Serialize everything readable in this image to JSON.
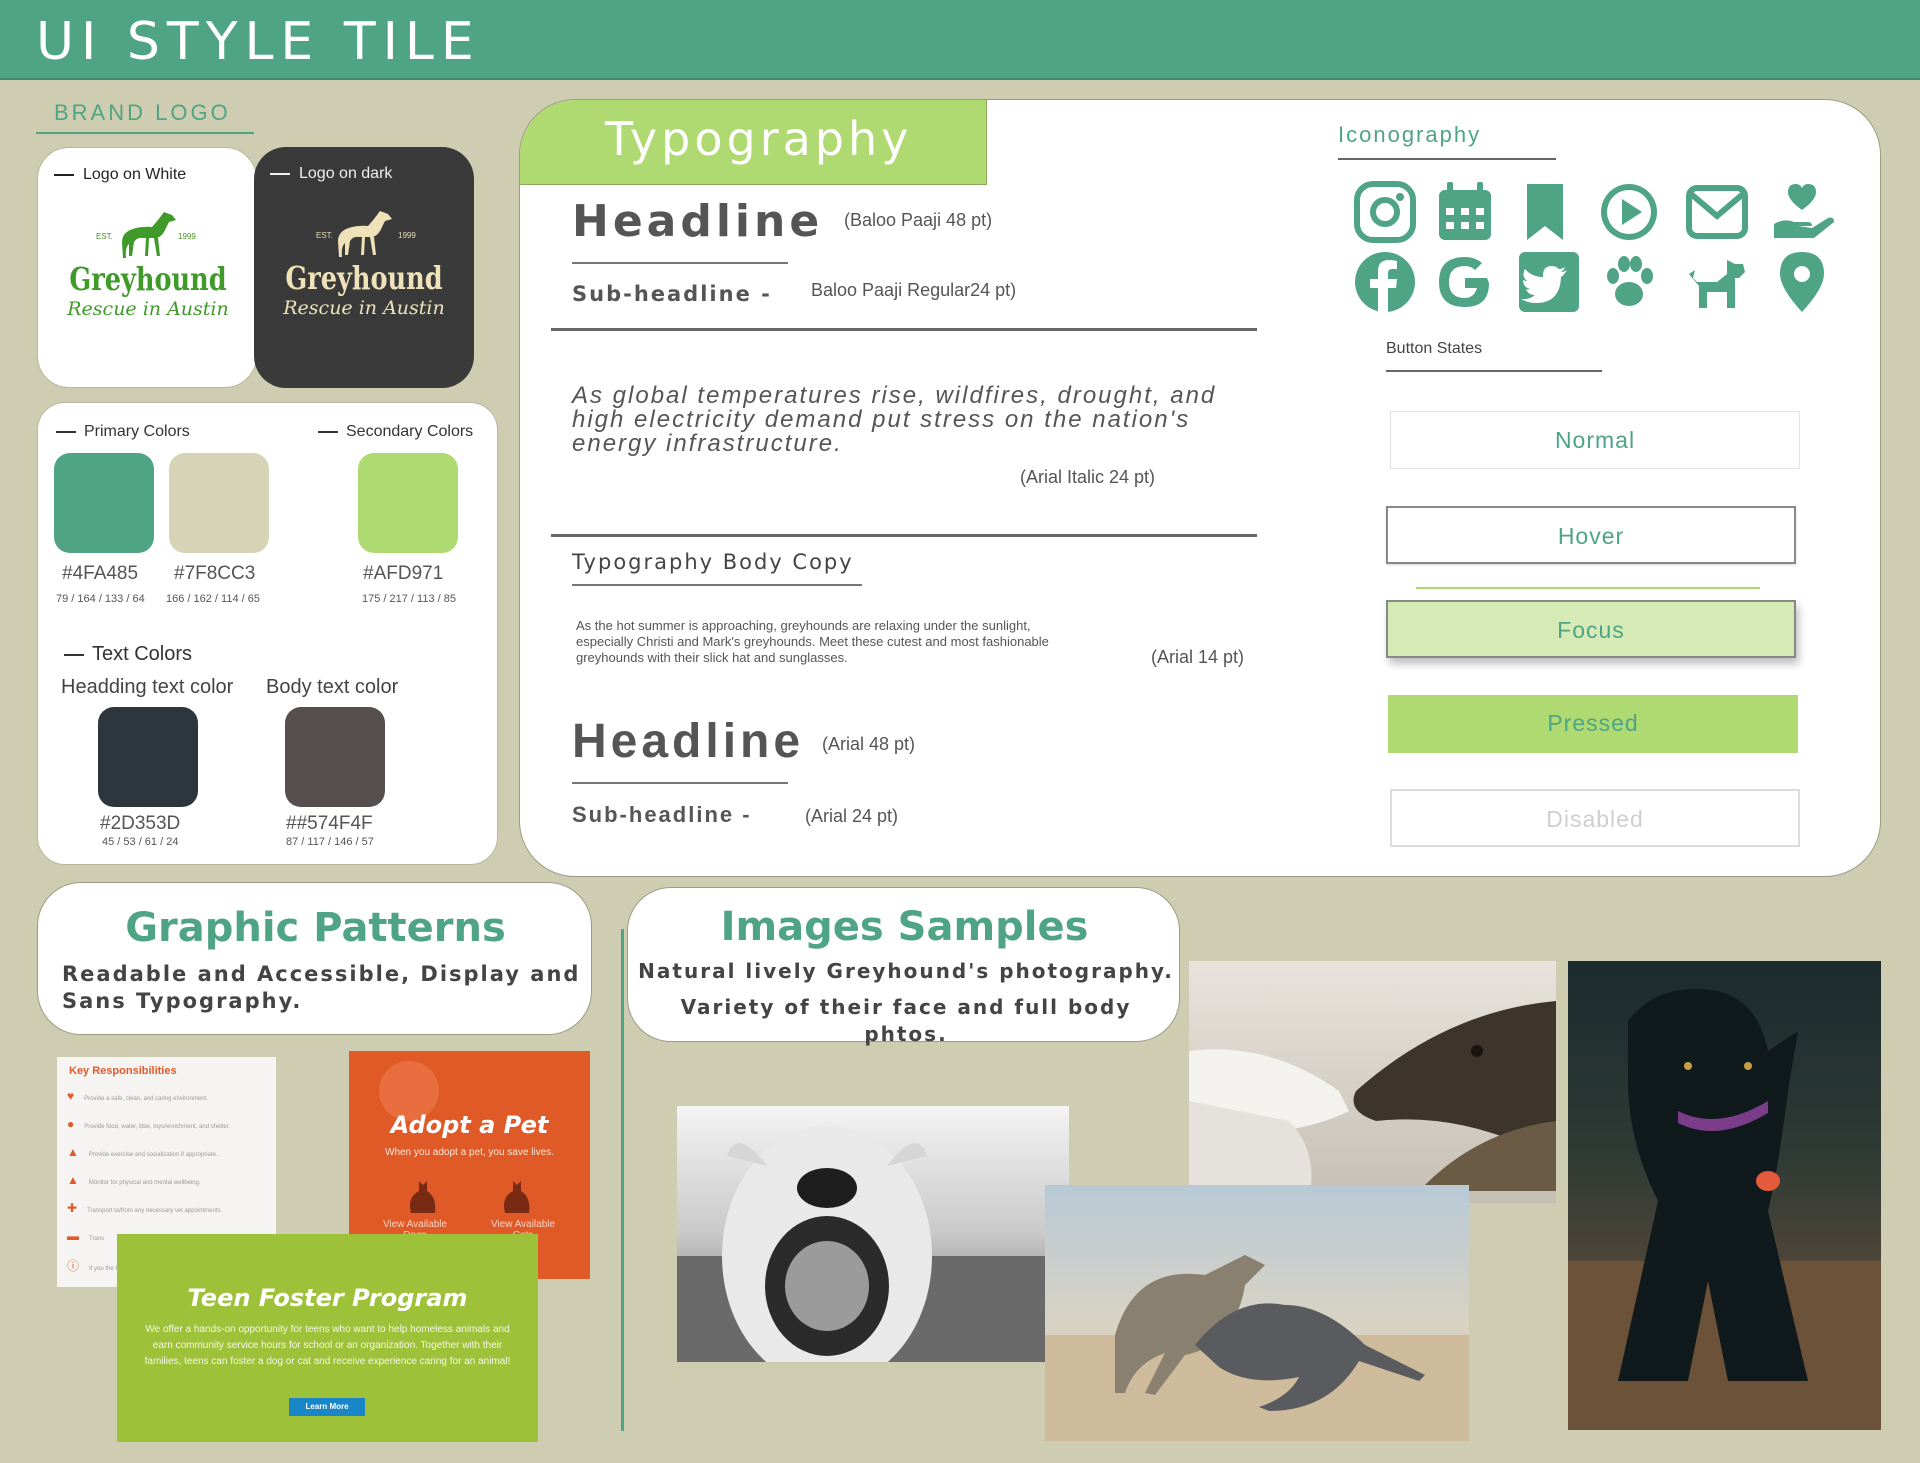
{
  "header": {
    "title": "UI STYLE TILE"
  },
  "brand": {
    "title": "BRAND LOGO",
    "logo_white_label": "Logo on White",
    "logo_dark_label": "Logo on dark",
    "logo_est": "EST.",
    "logo_year": "1999",
    "logo_word": "Greyhound",
    "logo_sub": "Rescue in Austin"
  },
  "colors": {
    "primary_label": "Primary Colors",
    "secondary_label": "Secondary Colors",
    "swatches": [
      {
        "hex": "#4FA485",
        "rgb": "79 / 164 / 133 / 64",
        "color": "#4FA485"
      },
      {
        "hex": "#7F8CC3",
        "rgb": "166 / 162 / 114 / 65",
        "color": "#d6d3b7"
      },
      {
        "hex": "#AFD971",
        "rgb": "175 / 217 / 113 / 85",
        "color": "#AFD971"
      }
    ],
    "text_colors_label": "Text Colors",
    "heading_label": "Headding text color",
    "body_label": "Body text color",
    "text_swatches": [
      {
        "hex": "#2D353D",
        "rgb": "45 / 53 / 61 / 24",
        "color": "#2D353D"
      },
      {
        "hex": "##574F4F",
        "rgb": "87 / 117 / 146 / 57",
        "color": "#574F4F"
      }
    ]
  },
  "typography": {
    "tab": "Typography",
    "headline1": "Headline",
    "headline1_note": "(Baloo Paaji 48 pt)",
    "sub1": "Sub-headline -",
    "sub1_note": "Baloo Paaji Regular24 pt)",
    "italic_copy": "As global temperatures rise, wildfires, drought, and high electricity demand put stress on the nation's energy infrastructure.",
    "italic_note": "(Arial   Italic 24 pt)",
    "body_title": "Typography Body Copy",
    "body_copy": "As the hot summer is approaching, greyhounds are relaxing under the sunlight, especially Christi and Mark's greyhounds. Meet these cutest and most fashionable greyhounds with their slick hat and sunglasses.",
    "body_note": "(Arial  14 pt)",
    "headline2": "Headline",
    "headline2_note": "(Arial  48 pt)",
    "sub2": "Sub-headline -",
    "sub2_note": "(Arial 24 pt)"
  },
  "iconography": {
    "title": "Iconography",
    "icons": [
      "instagram-icon",
      "calendar-icon",
      "bookmark-icon",
      "play-icon",
      "mail-icon",
      "heart-hand-icon",
      "facebook-icon",
      "google-icon",
      "twitter-icon",
      "paw-icon",
      "dog-icon",
      "location-pin-icon"
    ],
    "color": "#4FA485"
  },
  "button_states": {
    "title": "Button States",
    "normal": "Normal",
    "hover": "Hover",
    "focus": "Focus",
    "pressed": "Pressed",
    "disabled": "Disabled"
  },
  "patterns": {
    "title": "Graphic Patterns",
    "subtitle": "Readable and Accessible, Display and Sans Typography.",
    "key_title": "Key Responsibilities",
    "key_items": [
      "Provide a safe, clean, and caring environment.",
      "Provide food, water, litter, toys/enrichment, and shelter.",
      "Provide exercise and socialization if appropriate.",
      "Monitor for physical and mental wellbeing.",
      "Transport to/from any necessary vet appointments.",
      "Trans",
      "If you the h"
    ],
    "adopt_title": "Adopt a Pet",
    "adopt_sub": "When you adopt a pet, you save lives.",
    "adopt_dogs": "View Available Dogs",
    "adopt_cats": "View Available Cats",
    "teen_title": "Teen Foster Program",
    "teen_body": "We offer a hands-on opportunity for teens who want to help homeless animals and earn community service hours for school or an organization. Together with their families, teens can foster a dog or cat and receive experience caring for an animal!",
    "teen_button": "Learn More"
  },
  "images": {
    "title": "Images Samples",
    "subtitle_1": "Natural lively Greyhound's photography.",
    "subtitle_2": "Variety of their face and full body phtos."
  }
}
